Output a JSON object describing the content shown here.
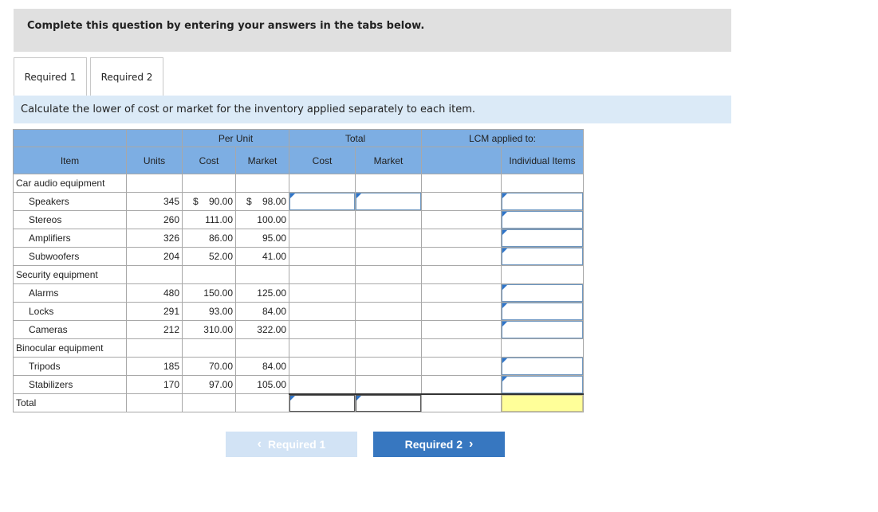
{
  "instruction": "Complete this question by entering your answers in the tabs below.",
  "tabs": [
    {
      "label": "Required 1",
      "active": true
    },
    {
      "label": "Required 2",
      "active": false
    }
  ],
  "prompt": "Calculate the lower of cost or market for the inventory applied separately to each item.",
  "table": {
    "group_headers": {
      "per_unit": "Per Unit",
      "total": "Total",
      "lcm": "LCM applied to:"
    },
    "headers": {
      "item": "Item",
      "units": "Units",
      "cost": "Cost",
      "market": "Market",
      "total_cost": "Cost",
      "total_market": "Market",
      "individual_items": "Individual Items"
    },
    "groups": [
      {
        "name": "Car audio equipment",
        "rows": [
          {
            "item": "Speakers",
            "units": "345",
            "cost": "90.00",
            "market": "98.00",
            "currency": "$"
          },
          {
            "item": "Stereos",
            "units": "260",
            "cost": "111.00",
            "market": "100.00"
          },
          {
            "item": "Amplifiers",
            "units": "326",
            "cost": "86.00",
            "market": "95.00"
          },
          {
            "item": "Subwoofers",
            "units": "204",
            "cost": "52.00",
            "market": "41.00"
          }
        ]
      },
      {
        "name": "Security equipment",
        "rows": [
          {
            "item": "Alarms",
            "units": "480",
            "cost": "150.00",
            "market": "125.00"
          },
          {
            "item": "Locks",
            "units": "291",
            "cost": "93.00",
            "market": "84.00"
          },
          {
            "item": "Cameras",
            "units": "212",
            "cost": "310.00",
            "market": "322.00"
          }
        ]
      },
      {
        "name": "Binocular equipment",
        "rows": [
          {
            "item": "Tripods",
            "units": "185",
            "cost": "70.00",
            "market": "84.00"
          },
          {
            "item": "Stabilizers",
            "units": "170",
            "cost": "97.00",
            "market": "105.00"
          }
        ]
      }
    ],
    "total_label": "Total"
  },
  "nav": {
    "prev_label": "Required 1",
    "next_label": "Required 2"
  },
  "colors": {
    "header_blue": "#7daee3",
    "prompt_bg": "#dbeaf7",
    "next_button": "#3777c0",
    "prev_button_disabled": "#d2e3f5",
    "total_highlight": "#ffff99"
  }
}
